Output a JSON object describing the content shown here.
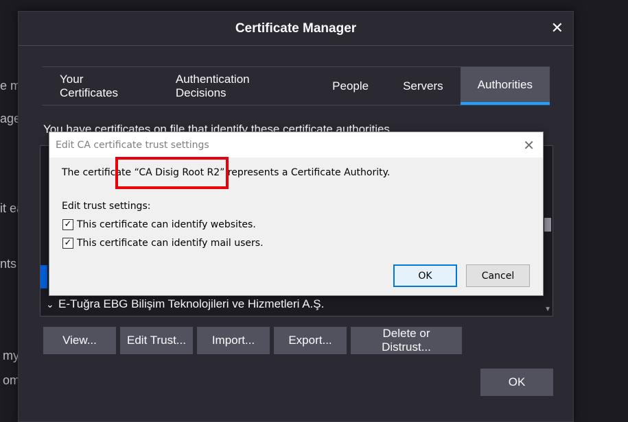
{
  "background_fragments": [
    "e m",
    "age",
    "it ea",
    "nts",
    "my",
    "om"
  ],
  "cert_manager": {
    "title": "Certificate Manager",
    "close_glyph": "✕",
    "tabs": [
      {
        "label": "Your Certificates",
        "active": false
      },
      {
        "label": "Authentication Decisions",
        "active": false
      },
      {
        "label": "People",
        "active": false
      },
      {
        "label": "Servers",
        "active": false
      },
      {
        "label": "Authorities",
        "active": true
      }
    ],
    "description": "You have certificates on file that identify these certificate authorities",
    "tree_visible_row": "E-Tuğra EBG Bilişim Teknolojileri ve Hizmetleri A.Ş.",
    "buttons": [
      "View...",
      "Edit Trust...",
      "Import...",
      "Export...",
      "Delete or Distrust..."
    ],
    "ok_label": "OK",
    "accent_color": "#1fa1ff"
  },
  "trust_dialog": {
    "title": "Edit CA certificate trust settings",
    "close_glyph": "✕",
    "message_prefix": "The certificate ",
    "cert_name": "“CA Disig Root R2”",
    "message_suffix": " represents a Certificate Authority.",
    "section_label": "Edit trust settings:",
    "options": [
      {
        "label": "This certificate can identify websites.",
        "checked": true
      },
      {
        "label": "This certificate can identify mail users.",
        "checked": true
      }
    ],
    "ok_label": "OK",
    "cancel_label": "Cancel"
  },
  "highlight_color": "#e8000b"
}
